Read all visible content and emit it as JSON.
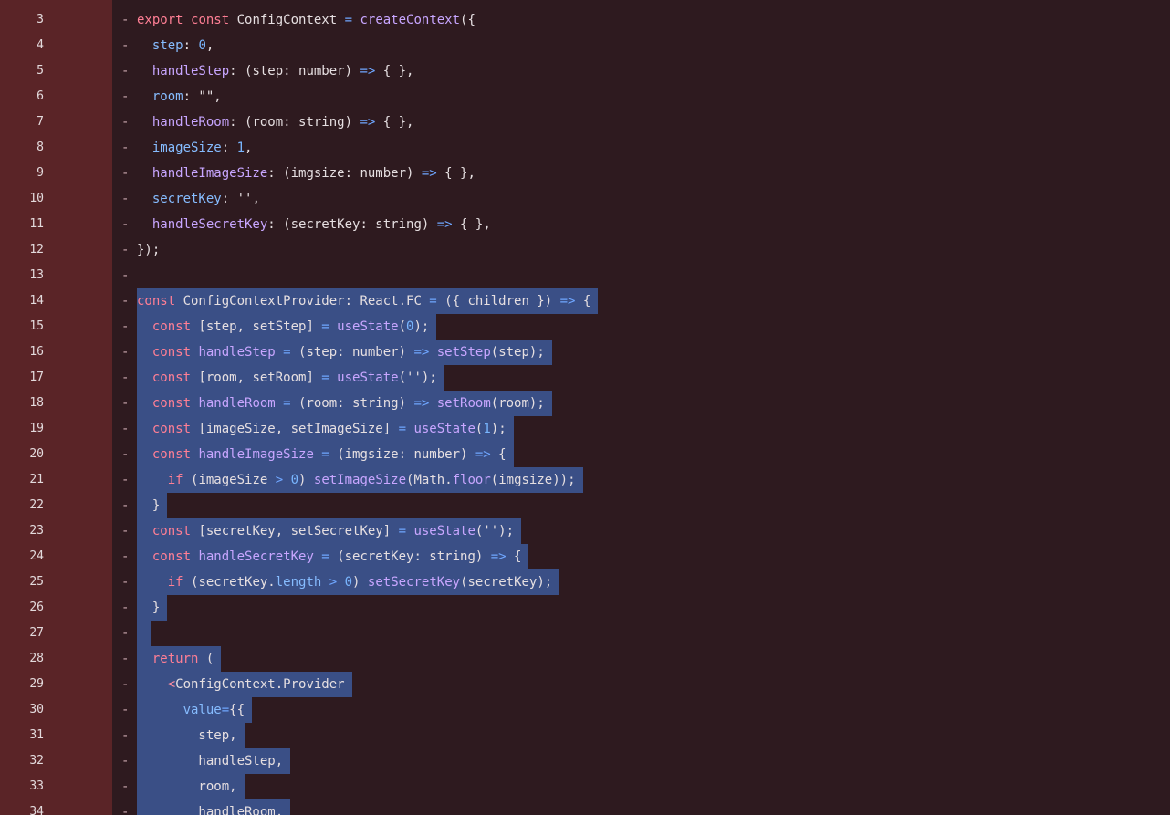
{
  "editor": {
    "colors": {
      "background": "#2e1a1f",
      "gutter": "#5a2427",
      "selection": "#3a4f86",
      "keyword": "#ff7f95",
      "function": "#c8a6ff",
      "property": "#86bcff",
      "number": "#79b6ff"
    },
    "diff_marker": "-",
    "lines": [
      {
        "n": "3",
        "sel": false,
        "tokens": [
          [
            "kw",
            "export "
          ],
          [
            "kw",
            "const "
          ],
          [
            "punc",
            "ConfigContext "
          ],
          [
            "op",
            "= "
          ],
          [
            "fn",
            "createContext"
          ],
          [
            "punc",
            "({"
          ]
        ]
      },
      {
        "n": "4",
        "sel": false,
        "tokens": [
          [
            "punc",
            "  "
          ],
          [
            "prop",
            "step"
          ],
          [
            "punc",
            ": "
          ],
          [
            "num",
            "0"
          ],
          [
            "punc",
            ","
          ]
        ]
      },
      {
        "n": "5",
        "sel": false,
        "tokens": [
          [
            "punc",
            "  "
          ],
          [
            "fn",
            "handleStep"
          ],
          [
            "punc",
            ": (step: number) "
          ],
          [
            "op",
            "=> "
          ],
          [
            "punc",
            "{ },"
          ]
        ]
      },
      {
        "n": "6",
        "sel": false,
        "tokens": [
          [
            "punc",
            "  "
          ],
          [
            "prop",
            "room"
          ],
          [
            "punc",
            ": "
          ],
          [
            "str",
            "\"\""
          ],
          [
            "punc",
            ","
          ]
        ]
      },
      {
        "n": "7",
        "sel": false,
        "tokens": [
          [
            "punc",
            "  "
          ],
          [
            "fn",
            "handleRoom"
          ],
          [
            "punc",
            ": (room: string) "
          ],
          [
            "op",
            "=> "
          ],
          [
            "punc",
            "{ },"
          ]
        ]
      },
      {
        "n": "8",
        "sel": false,
        "tokens": [
          [
            "punc",
            "  "
          ],
          [
            "prop",
            "imageSize"
          ],
          [
            "punc",
            ": "
          ],
          [
            "num",
            "1"
          ],
          [
            "punc",
            ","
          ]
        ]
      },
      {
        "n": "9",
        "sel": false,
        "tokens": [
          [
            "punc",
            "  "
          ],
          [
            "fn",
            "handleImageSize"
          ],
          [
            "punc",
            ": (imgsize: number) "
          ],
          [
            "op",
            "=> "
          ],
          [
            "punc",
            "{ },"
          ]
        ]
      },
      {
        "n": "10",
        "sel": false,
        "tokens": [
          [
            "punc",
            "  "
          ],
          [
            "prop",
            "secretKey"
          ],
          [
            "punc",
            ": "
          ],
          [
            "str",
            "''"
          ],
          [
            "punc",
            ","
          ]
        ]
      },
      {
        "n": "11",
        "sel": false,
        "tokens": [
          [
            "punc",
            "  "
          ],
          [
            "fn",
            "handleSecretKey"
          ],
          [
            "punc",
            ": (secretKey: string) "
          ],
          [
            "op",
            "=> "
          ],
          [
            "punc",
            "{ },"
          ]
        ]
      },
      {
        "n": "12",
        "sel": false,
        "tokens": [
          [
            "punc",
            "});"
          ]
        ]
      },
      {
        "n": "13",
        "sel": false,
        "tokens": []
      },
      {
        "n": "14",
        "sel": true,
        "tokens": [
          [
            "kw",
            "const "
          ],
          [
            "punc",
            "ConfigContextProvider: React.FC "
          ],
          [
            "op",
            "= "
          ],
          [
            "punc",
            "({ children }) "
          ],
          [
            "op",
            "=> "
          ],
          [
            "punc",
            "{"
          ]
        ]
      },
      {
        "n": "15",
        "sel": true,
        "tokens": [
          [
            "punc",
            "  "
          ],
          [
            "kw",
            "const "
          ],
          [
            "punc",
            "[step, setStep] "
          ],
          [
            "op",
            "= "
          ],
          [
            "fn",
            "useState"
          ],
          [
            "punc",
            "("
          ],
          [
            "num",
            "0"
          ],
          [
            "punc",
            ");"
          ]
        ]
      },
      {
        "n": "16",
        "sel": true,
        "tokens": [
          [
            "punc",
            "  "
          ],
          [
            "kw",
            "const "
          ],
          [
            "fn",
            "handleStep "
          ],
          [
            "op",
            "= "
          ],
          [
            "punc",
            "(step: number) "
          ],
          [
            "op",
            "=> "
          ],
          [
            "fn",
            "setStep"
          ],
          [
            "punc",
            "(step);"
          ]
        ]
      },
      {
        "n": "17",
        "sel": true,
        "tokens": [
          [
            "punc",
            "  "
          ],
          [
            "kw",
            "const "
          ],
          [
            "punc",
            "[room, setRoom] "
          ],
          [
            "op",
            "= "
          ],
          [
            "fn",
            "useState"
          ],
          [
            "punc",
            "('');"
          ]
        ]
      },
      {
        "n": "18",
        "sel": true,
        "tokens": [
          [
            "punc",
            "  "
          ],
          [
            "kw",
            "const "
          ],
          [
            "fn",
            "handleRoom "
          ],
          [
            "op",
            "= "
          ],
          [
            "punc",
            "(room: string) "
          ],
          [
            "op",
            "=> "
          ],
          [
            "fn",
            "setRoom"
          ],
          [
            "punc",
            "(room);"
          ]
        ]
      },
      {
        "n": "19",
        "sel": true,
        "tokens": [
          [
            "punc",
            "  "
          ],
          [
            "kw",
            "const "
          ],
          [
            "punc",
            "[imageSize, setImageSize] "
          ],
          [
            "op",
            "= "
          ],
          [
            "fn",
            "useState"
          ],
          [
            "punc",
            "("
          ],
          [
            "num",
            "1"
          ],
          [
            "punc",
            ");"
          ]
        ]
      },
      {
        "n": "20",
        "sel": true,
        "tokens": [
          [
            "punc",
            "  "
          ],
          [
            "kw",
            "const "
          ],
          [
            "fn",
            "handleImageSize "
          ],
          [
            "op",
            "= "
          ],
          [
            "punc",
            "(imgsize: number) "
          ],
          [
            "op",
            "=> "
          ],
          [
            "punc",
            "{"
          ]
        ]
      },
      {
        "n": "21",
        "sel": true,
        "tokens": [
          [
            "punc",
            "    "
          ],
          [
            "kw",
            "if "
          ],
          [
            "punc",
            "(imageSize "
          ],
          [
            "op",
            "> "
          ],
          [
            "num",
            "0"
          ],
          [
            "punc",
            ") "
          ],
          [
            "fn",
            "setImageSize"
          ],
          [
            "punc",
            "(Math."
          ],
          [
            "fn",
            "floor"
          ],
          [
            "punc",
            "(imgsize));"
          ]
        ]
      },
      {
        "n": "22",
        "sel": true,
        "tokens": [
          [
            "punc",
            "  }"
          ]
        ]
      },
      {
        "n": "23",
        "sel": true,
        "tokens": [
          [
            "punc",
            "  "
          ],
          [
            "kw",
            "const "
          ],
          [
            "punc",
            "[secretKey, setSecretKey] "
          ],
          [
            "op",
            "= "
          ],
          [
            "fn",
            "useState"
          ],
          [
            "punc",
            "('');"
          ]
        ]
      },
      {
        "n": "24",
        "sel": true,
        "tokens": [
          [
            "punc",
            "  "
          ],
          [
            "kw",
            "const "
          ],
          [
            "fn",
            "handleSecretKey "
          ],
          [
            "op",
            "= "
          ],
          [
            "punc",
            "(secretKey: string) "
          ],
          [
            "op",
            "=> "
          ],
          [
            "punc",
            "{"
          ]
        ]
      },
      {
        "n": "25",
        "sel": true,
        "tokens": [
          [
            "punc",
            "    "
          ],
          [
            "kw",
            "if "
          ],
          [
            "punc",
            "(secretKey."
          ],
          [
            "prop",
            "length "
          ],
          [
            "op",
            "> "
          ],
          [
            "num",
            "0"
          ],
          [
            "punc",
            ") "
          ],
          [
            "fn",
            "setSecretKey"
          ],
          [
            "punc",
            "(secretKey);"
          ]
        ]
      },
      {
        "n": "26",
        "sel": true,
        "tokens": [
          [
            "punc",
            "  }"
          ]
        ]
      },
      {
        "n": "27",
        "sel": true,
        "tokens": [
          [
            "punc",
            " "
          ]
        ]
      },
      {
        "n": "28",
        "sel": true,
        "tokens": [
          [
            "punc",
            "  "
          ],
          [
            "kw",
            "return "
          ],
          [
            "punc",
            "("
          ]
        ]
      },
      {
        "n": "29",
        "sel": true,
        "tokens": [
          [
            "punc",
            "    "
          ],
          [
            "tag",
            "<"
          ],
          [
            "punc",
            "ConfigContext.Provider"
          ]
        ]
      },
      {
        "n": "30",
        "sel": true,
        "tokens": [
          [
            "punc",
            "      "
          ],
          [
            "prop",
            "value"
          ],
          [
            "op",
            "="
          ],
          [
            "punc",
            "{{"
          ]
        ]
      },
      {
        "n": "31",
        "sel": true,
        "tokens": [
          [
            "punc",
            "        step,"
          ]
        ]
      },
      {
        "n": "32",
        "sel": true,
        "tokens": [
          [
            "punc",
            "        handleStep,"
          ]
        ]
      },
      {
        "n": "33",
        "sel": true,
        "tokens": [
          [
            "punc",
            "        room,"
          ]
        ]
      },
      {
        "n": "34",
        "sel": true,
        "tokens": [
          [
            "punc",
            "        handleRoom,"
          ]
        ]
      }
    ]
  }
}
